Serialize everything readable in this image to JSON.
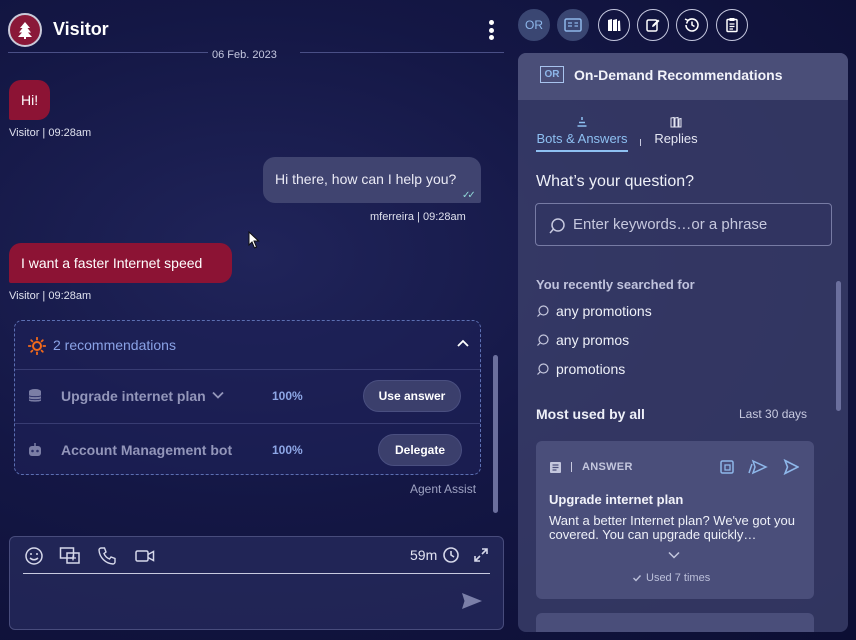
{
  "header": {
    "title": "Visitor",
    "date": "06 Feb. 2023"
  },
  "messages": [
    {
      "from": "visitor",
      "text": "Hi!",
      "meta": "Visitor | 09:28am"
    },
    {
      "from": "agent",
      "text": "Hi there, how can I help you?",
      "meta": "mferreira | 09:28am"
    },
    {
      "from": "visitor",
      "text": "I want a faster Internet speed",
      "meta": "Visitor | 09:28am"
    }
  ],
  "recommendations": {
    "title": "2 recommendations",
    "items": [
      {
        "name": "Upgrade internet plan",
        "score": "100%",
        "action": "Use answer"
      },
      {
        "name": "Account Management bot",
        "score": "100%",
        "action": "Delegate"
      }
    ],
    "footer": "Agent Assist"
  },
  "composer": {
    "timer": "59m"
  },
  "toolbar": {
    "or_label": "OR"
  },
  "panel": {
    "badge": "OR",
    "title": "On-Demand Recommendations",
    "tabs": [
      {
        "label": "Bots & Answers",
        "active": true
      },
      {
        "label": "Replies",
        "active": false
      }
    ],
    "question": "What’s your question?",
    "search_placeholder": "Enter keywords…or a phrase",
    "recent_title": "You recently searched for",
    "recent": [
      "any promotions",
      "any promos",
      "promotions"
    ],
    "most_used_title": "Most used by all",
    "period": "Last 30 days",
    "card": {
      "kind": "ANSWER",
      "title": "Upgrade internet plan",
      "body": "Want a better Internet plan? We've got you covered. You can upgrade quickly…",
      "used": "Used 7 times"
    }
  },
  "colors": {
    "visitor_bubble": "#8c1334",
    "agent_bubble": "#404470",
    "accent": "#8ec0f2"
  }
}
